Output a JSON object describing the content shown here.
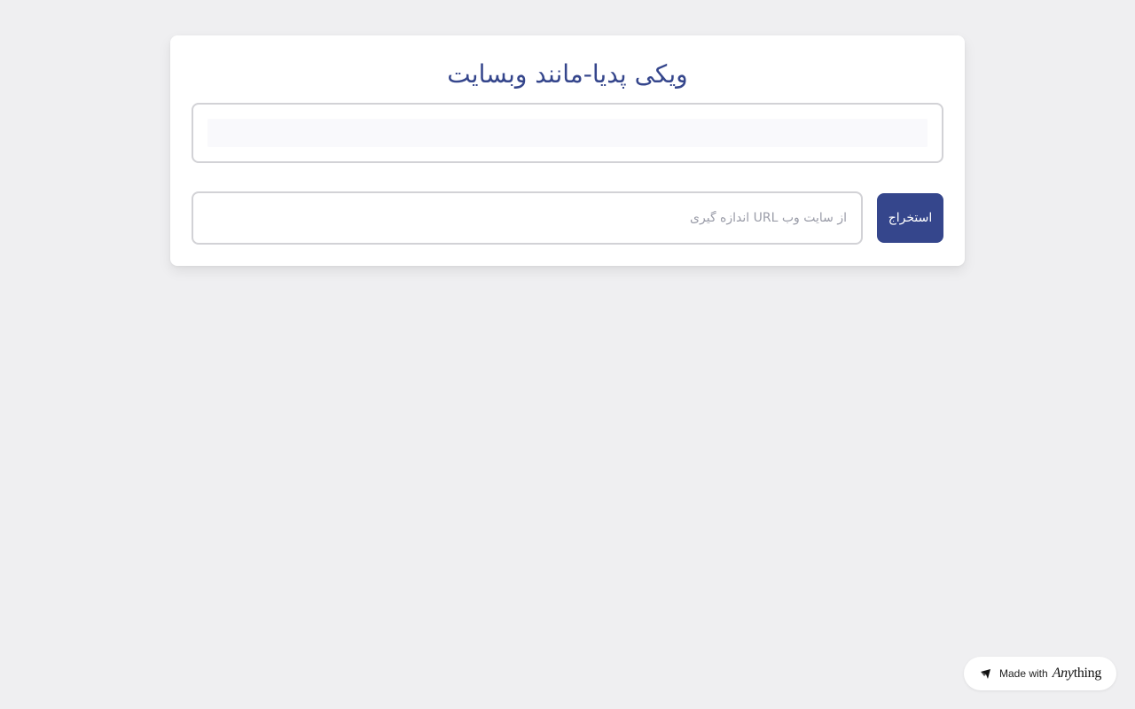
{
  "app": {
    "title": "ویکی پدیا-مانند وبسایت"
  },
  "form": {
    "url_placeholder": "از سایت وب URL اندازه گیری",
    "url_value": "",
    "extract_label": "استخراج"
  },
  "badge": {
    "made_with_label": "Made with",
    "brand_italic": "Any",
    "brand_rest": "thing"
  },
  "colors": {
    "accent": "#35468c",
    "background": "#efeff1",
    "card": "#ffffff",
    "border": "#d2d2d6"
  }
}
